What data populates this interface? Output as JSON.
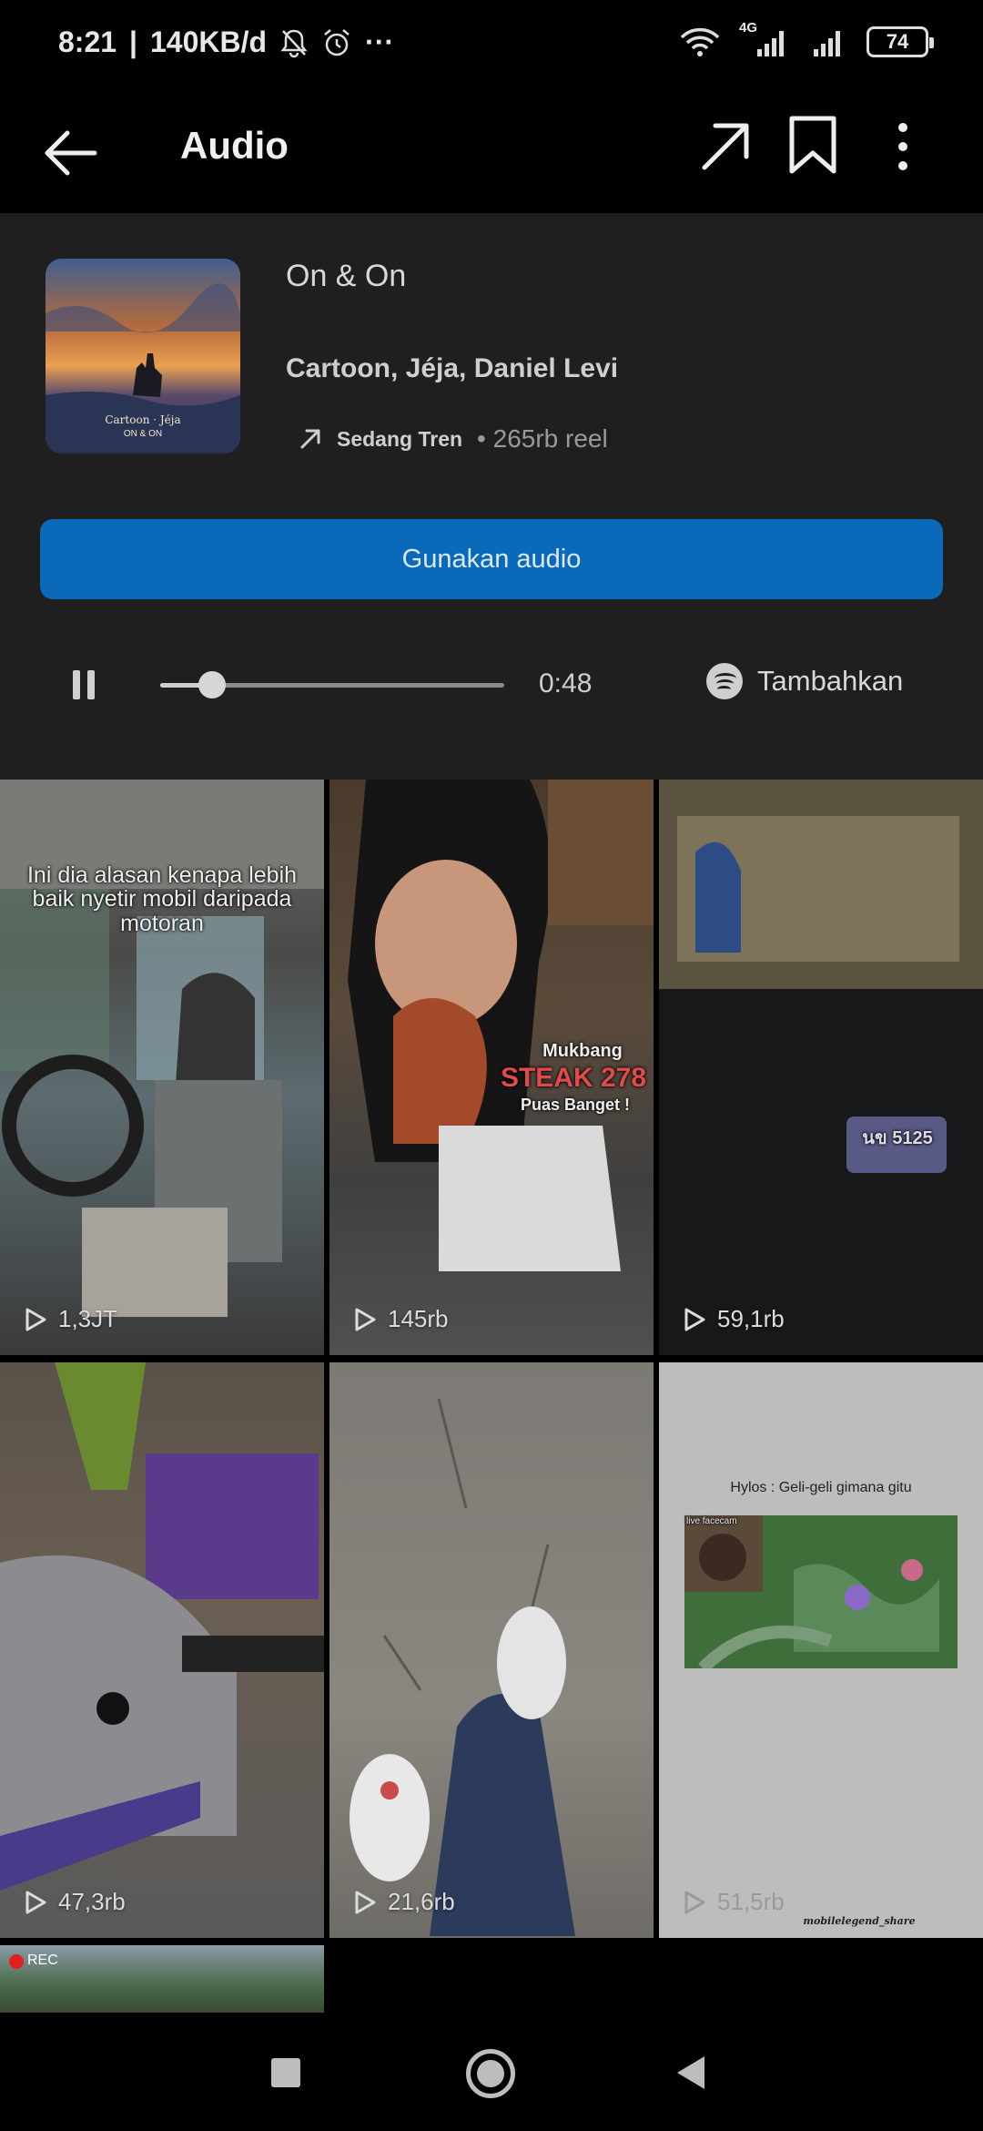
{
  "status_bar": {
    "time": "8:21",
    "network_speed": "140KB/d",
    "more": "···",
    "network_type": "4G",
    "battery": "74"
  },
  "app_bar": {
    "title": "Audio"
  },
  "track": {
    "title": "On & On",
    "artists": "Cartoon, Jéja, Daniel Levi",
    "trend_label": "Sedang Tren",
    "reel_count": "• 265rb reel",
    "cover_title": "Cartoon · Jéja",
    "cover_subtitle": "ON & ON"
  },
  "actions": {
    "use_audio": "Gunakan audio",
    "spotify": "Tambahkan"
  },
  "player": {
    "time": "0:48",
    "progress": 0.15
  },
  "reels": [
    {
      "views": "1,3JT",
      "caption": "Ini dia alasan kenapa lebih baik nyetir mobil daripada motoran"
    },
    {
      "views": "145rb",
      "caption_top": "Mukbang",
      "caption_main": "STEAK 278",
      "caption_bottom": "Puas Banget !"
    },
    {
      "views": "59,1rb",
      "plate": "นข 5125"
    },
    {
      "views": "47,3rb"
    },
    {
      "views": "21,6rb"
    },
    {
      "views": "51,5rb",
      "caption": "Hylos : Geli-geli gimana gitu",
      "inset_label": "live facecam",
      "watermark": "mobilelegend_share"
    },
    {
      "badge": "REC"
    }
  ],
  "colors": {
    "accent": "#0a6ab9",
    "panel": "#1f1f20",
    "background": "#000000"
  }
}
